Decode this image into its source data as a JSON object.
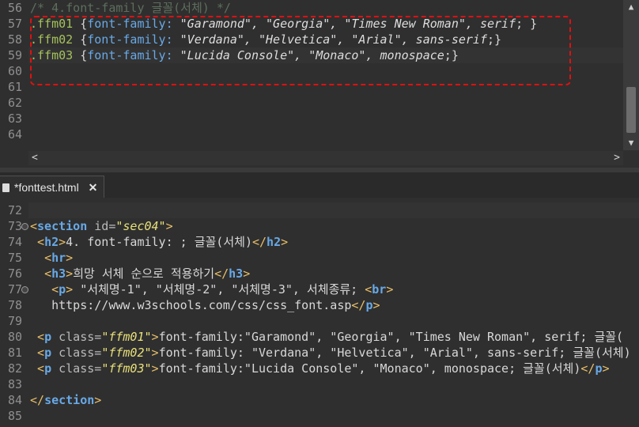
{
  "top_editor": {
    "lines": [
      {
        "no": "56",
        "tokens": [
          {
            "c": "cm",
            "t": "/* 4.font-family 글꼴(서체) */"
          }
        ]
      },
      {
        "no": "57",
        "tokens": [
          {
            "c": "sel",
            "t": ".ffm01"
          },
          {
            "c": "plain",
            "t": " {"
          },
          {
            "c": "prop",
            "t": "font-family:"
          },
          {
            "c": "str",
            "t": " \"Garamond\", \"Georgia\", \"Times New Roman\", serif"
          },
          {
            "c": "plain",
            "t": "; }"
          }
        ]
      },
      {
        "no": "58",
        "tokens": [
          {
            "c": "sel",
            "t": ".ffm02"
          },
          {
            "c": "plain",
            "t": " {"
          },
          {
            "c": "prop",
            "t": "font-family:"
          },
          {
            "c": "str",
            "t": " \"Verdana\", \"Helvetica\", \"Arial\", sans-serif"
          },
          {
            "c": "plain",
            "t": ";}"
          }
        ]
      },
      {
        "no": "59",
        "tokens": [
          {
            "c": "sel",
            "t": ".ffm03"
          },
          {
            "c": "plain",
            "t": " {"
          },
          {
            "c": "prop",
            "t": "font-family:"
          },
          {
            "c": "str",
            "t": " \"Lucida Console\", \"Monaco\", monospace"
          },
          {
            "c": "plain",
            "t": ";}"
          }
        ]
      },
      {
        "no": "60",
        "tokens": []
      },
      {
        "no": "61",
        "tokens": []
      },
      {
        "no": "62",
        "tokens": []
      },
      {
        "no": "63",
        "tokens": []
      },
      {
        "no": "64",
        "tokens": []
      }
    ],
    "scroll_left": "<",
    "scroll_right": ">",
    "scroll_up": "▲",
    "scroll_down": "▼"
  },
  "tab": {
    "label": "*fonttest.html",
    "close": "✕"
  },
  "bottom_editor": {
    "lines": [
      {
        "no": "72",
        "tokens": []
      },
      {
        "no": "73",
        "fold": true,
        "tokens": [
          {
            "c": "tag",
            "t": "<"
          },
          {
            "c": "tagname",
            "t": "section"
          },
          {
            "c": "attr",
            "t": " id="
          },
          {
            "c": "attrval",
            "t": "\"sec04\""
          },
          {
            "c": "tag",
            "t": ">"
          }
        ]
      },
      {
        "no": "74",
        "tokens": [
          {
            "c": "plain",
            "t": " "
          },
          {
            "c": "tag",
            "t": "<"
          },
          {
            "c": "tagname",
            "t": "h2"
          },
          {
            "c": "tag",
            "t": ">"
          },
          {
            "c": "plain",
            "t": "4. font-family: ; 글꼴(서체)"
          },
          {
            "c": "tag",
            "t": "</"
          },
          {
            "c": "tagname",
            "t": "h2"
          },
          {
            "c": "tag",
            "t": ">"
          }
        ]
      },
      {
        "no": "75",
        "tokens": [
          {
            "c": "plain",
            "t": "  "
          },
          {
            "c": "tag",
            "t": "<"
          },
          {
            "c": "tagname",
            "t": "hr"
          },
          {
            "c": "tag",
            "t": ">"
          }
        ]
      },
      {
        "no": "76",
        "tokens": [
          {
            "c": "plain",
            "t": "  "
          },
          {
            "c": "tag",
            "t": "<"
          },
          {
            "c": "tagname",
            "t": "h3"
          },
          {
            "c": "tag",
            "t": ">"
          },
          {
            "c": "plain",
            "t": "희망 서체 순으로 적용하기"
          },
          {
            "c": "tag",
            "t": "</"
          },
          {
            "c": "tagname",
            "t": "h3"
          },
          {
            "c": "tag",
            "t": ">"
          }
        ]
      },
      {
        "no": "77",
        "fold": true,
        "tokens": [
          {
            "c": "plain",
            "t": "   "
          },
          {
            "c": "tag",
            "t": "<"
          },
          {
            "c": "tagname",
            "t": "p"
          },
          {
            "c": "tag",
            "t": ">"
          },
          {
            "c": "plain",
            "t": " \"서체명-1\", \"서체명-2\", \"서체명-3\", 서체종류; "
          },
          {
            "c": "tag",
            "t": "<"
          },
          {
            "c": "tagname",
            "t": "br"
          },
          {
            "c": "tag",
            "t": ">"
          }
        ]
      },
      {
        "no": "78",
        "tokens": [
          {
            "c": "plain",
            "t": "   https://www.w3schools.com/css/css_font.asp"
          },
          {
            "c": "tag",
            "t": "</"
          },
          {
            "c": "tagname",
            "t": "p"
          },
          {
            "c": "tag",
            "t": ">"
          }
        ]
      },
      {
        "no": "79",
        "tokens": []
      },
      {
        "no": "80",
        "tokens": [
          {
            "c": "plain",
            "t": " "
          },
          {
            "c": "tag",
            "t": "<"
          },
          {
            "c": "tagname",
            "t": "p"
          },
          {
            "c": "attr",
            "t": " class="
          },
          {
            "c": "attrval",
            "t": "\"ffm01\""
          },
          {
            "c": "tag",
            "t": ">"
          },
          {
            "c": "plain",
            "t": "font-family:\"Garamond\", \"Georgia\", \"Times New Roman\", serif; 글꼴("
          }
        ]
      },
      {
        "no": "81",
        "tokens": [
          {
            "c": "plain",
            "t": " "
          },
          {
            "c": "tag",
            "t": "<"
          },
          {
            "c": "tagname",
            "t": "p"
          },
          {
            "c": "attr",
            "t": " class="
          },
          {
            "c": "attrval",
            "t": "\"ffm02\""
          },
          {
            "c": "tag",
            "t": ">"
          },
          {
            "c": "plain",
            "t": "font-family: \"Verdana\", \"Helvetica\", \"Arial\", sans-serif; 글꼴(서체)"
          }
        ]
      },
      {
        "no": "82",
        "tokens": [
          {
            "c": "plain",
            "t": " "
          },
          {
            "c": "tag",
            "t": "<"
          },
          {
            "c": "tagname",
            "t": "p"
          },
          {
            "c": "attr",
            "t": " class="
          },
          {
            "c": "attrval",
            "t": "\"ffm03\""
          },
          {
            "c": "tag",
            "t": ">"
          },
          {
            "c": "plain",
            "t": "font-family:\"Lucida Console\", \"Monaco\", monospace; 글꼴(서체)"
          },
          {
            "c": "tag",
            "t": "</"
          },
          {
            "c": "tagname",
            "t": "p"
          },
          {
            "c": "tag",
            "t": ">"
          }
        ]
      },
      {
        "no": "83",
        "tokens": []
      },
      {
        "no": "84",
        "tokens": [
          {
            "c": "tag",
            "t": "</"
          },
          {
            "c": "tagname",
            "t": "section"
          },
          {
            "c": "tag",
            "t": ">"
          }
        ]
      },
      {
        "no": "85",
        "tokens": []
      }
    ]
  }
}
